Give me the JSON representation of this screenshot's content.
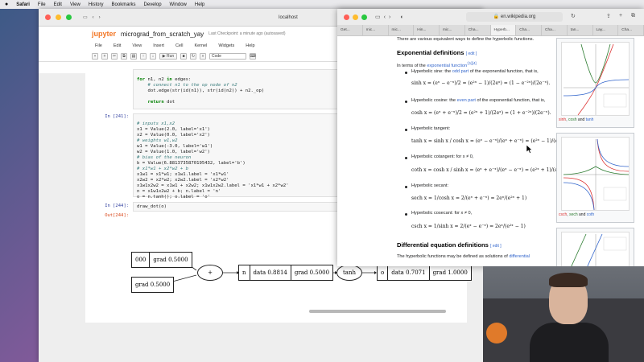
{
  "menubar": {
    "apple": "",
    "items": [
      "Safari",
      "File",
      "Edit",
      "View",
      "History",
      "Bookmarks",
      "Develop",
      "Window",
      "Help"
    ]
  },
  "left_window": {
    "address": "localhost",
    "jupyter": {
      "logo": "jupyter",
      "notebook_title": "micrograd_from_scratch_yay",
      "checkpoint": "Last Checkpoint: a minute ago  (autosaved)",
      "menu": [
        "File",
        "Edit",
        "View",
        "Insert",
        "Cell",
        "Kernel",
        "Widgets",
        "Help"
      ],
      "toolbar_run": "Run",
      "cell_type": "Code"
    },
    "cells": {
      "top_lines": [
        "for n1, n2 in edges:",
        "    # connect n1 to the op node of n2",
        "    dot.edge(str(id(n1)), str(id(n2)) + n2._op)",
        "",
        "return dot"
      ],
      "in241_prompt": "In [241]:",
      "in241_lines": [
        "# inputs x1,x2",
        "x1 = Value(2.0, label='x1')",
        "x2 = Value(0.0, label='x2')",
        "# weights w1,w2",
        "w1 = Value(-3.0, label='w1')",
        "w2 = Value(1.0, label='w2')",
        "# bias of the neuron",
        "b = Value(6.8813735870195432, label='b')",
        "# x1*w1 + x2*w2 + b",
        "x1w1 = x1*w1; x1w1.label = 'x1*w1'",
        "x2w2 = x2*w2; x2w2.label = 'x2*w2'",
        "x1w1x2w2 = x1w1 + x2w2; x1w1x2w2.label = 'x1*w1 + x2*w2'",
        "n = x1w1x2w2 + b; n.label = 'n'",
        "o = n.tanh(); o.label = 'o'"
      ],
      "in244_prompt": "In [244]:",
      "in244_code": "draw_dot(o)",
      "out244_prompt": "Out[244]:"
    },
    "graph": {
      "node1_data": "000",
      "node1_grad": "grad 0.5000",
      "node2_grad": "grad 0.5000",
      "plus_op": "+",
      "n_label": "n",
      "n_data": "data 0.8814",
      "n_grad": "grad 0.5000",
      "tanh_op": "tanh",
      "o_label": "o",
      "o_data": "data 0.7071",
      "o_grad": "grad 1.0000"
    }
  },
  "right_window": {
    "url": "en.wikipedia.org",
    "tabs": [
      "Get...",
      "mic...",
      "mic...",
      "Hin...",
      "mic...",
      "Cha...",
      "Hyperb...",
      "Cha...",
      "Cha...",
      "tan...",
      "Lay...",
      "Cha..."
    ],
    "active_tab_index": 6,
    "wiki": {
      "intro": "There are various equivalent ways to define the hyperbolic functions.",
      "h_exponential": "Exponential definitions",
      "edit": "[ edit ]",
      "exp_intro_a": "In terms of the ",
      "exp_intro_link": "exponential function",
      "exp_intro_sup": ":[1][4]",
      "sinh_a": "Hyperbolic sine: the ",
      "sinh_link": "odd part",
      "sinh_b": " of the exponential function, that is,",
      "sinh_eq": "sinh x = (eˣ − e⁻ˣ)/2 = (e²ˣ − 1)/(2eˣ) = (1 − e⁻²ˣ)/(2e⁻ˣ).",
      "cosh_a": "Hyperbolic cosine: the ",
      "cosh_link": "even part",
      "cosh_b": " of the exponential function, that is,",
      "cosh_eq": "cosh x = (eˣ + e⁻ˣ)/2 = (e²ˣ + 1)/(2eˣ) = (1 + e⁻²ˣ)/(2e⁻ˣ).",
      "tanh_t": "Hyperbolic tangent:",
      "tanh_eq": "tanh x = sinh x / cosh x = (eˣ − e⁻ˣ)/(eˣ + e⁻ˣ) = (e²ˣ − 1)/(e²ˣ + 1)",
      "coth_t": "Hyperbolic cotangent: for x ≠ 0,",
      "coth_eq": "coth x = cosh x / sinh x = (eˣ + e⁻ˣ)/(eˣ − e⁻ˣ) = (e²ˣ + 1)/(e²ˣ − 1)",
      "sech_t": "Hyperbolic secant:",
      "sech_eq": "sech x = 1/cosh x = 2/(eˣ + e⁻ˣ) = 2eˣ/(e²ˣ + 1)",
      "csch_t": "Hyperbolic cosecant: for x ≠ 0,",
      "csch_eq": "csch x = 1/sinh x = 2/(eˣ − e⁻ˣ) = 2eˣ/(e²ˣ − 1)",
      "h_diff": "Differential equation definitions",
      "diff_a": "The hyperbolic functions may be defined as solutions of ",
      "diff_link": "differential",
      "cap1_sinh": "sinh",
      "cap1_cosh": "cosh",
      "cap1_tanh": "tanh",
      "cap2_csch": "csch",
      "cap2_sech": "sech",
      "cap2_coth": "coth",
      "cap_and": " and ",
      "cap_comma": ", "
    }
  },
  "colors": {
    "jupyter_orange": "#f37726",
    "wiki_link": "#3366cc",
    "prompt_in": "#303f9f",
    "prompt_out": "#d84315"
  }
}
